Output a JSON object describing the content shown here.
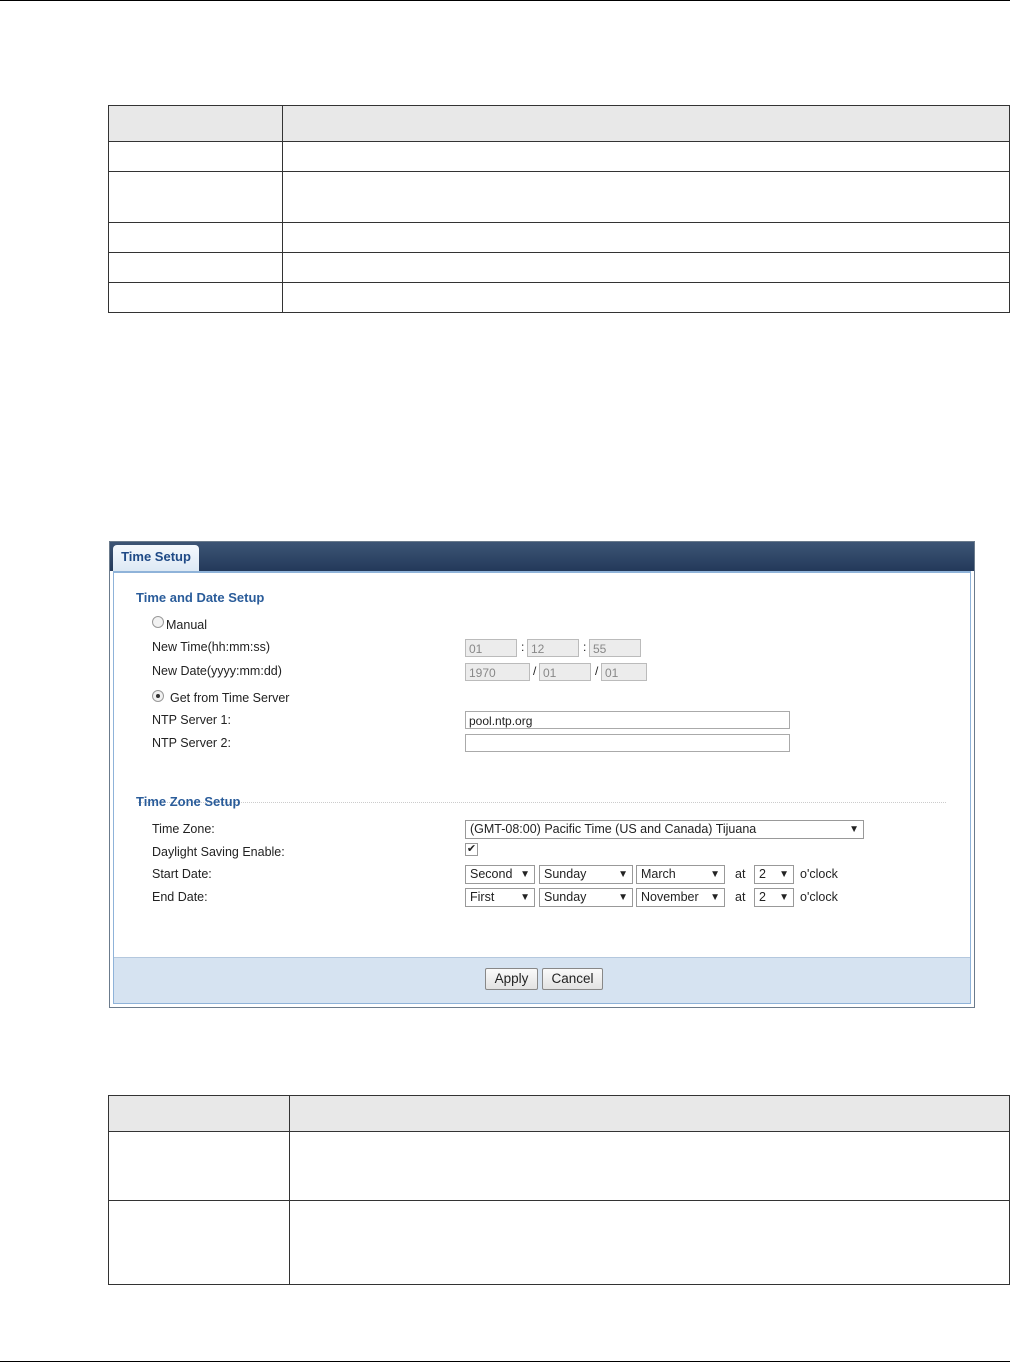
{
  "panel": {
    "tab_label": "Time Setup",
    "date_section": {
      "title": "Time and Date Setup",
      "manual_label": "Manual",
      "new_time_label": "New Time(hh:mm:ss)",
      "time_hh": "01",
      "time_mm": "12",
      "time_ss": "55",
      "time_sep": ":",
      "new_date_label": "New Date(yyyy:mm:dd)",
      "date_yyyy": "1970",
      "date_mm": "01",
      "date_dd": "01",
      "date_sep": "/",
      "server_label": "Get from Time Server",
      "ntp1_label": "NTP Server 1:",
      "ntp1_value": "pool.ntp.org",
      "ntp2_label": "NTP Server 2:",
      "ntp2_value": ""
    },
    "zone_section": {
      "title": "Time Zone Setup",
      "zone_label": "Time Zone:",
      "zone_value": "(GMT-08:00) Pacific Time (US and Canada) Tijuana",
      "dst_label": "Daylight Saving Enable:",
      "dst_checked": true,
      "start_label": "Start Date:",
      "start_week": "Second",
      "start_day": "Sunday",
      "start_month": "March",
      "start_hour": "2",
      "end_label": "End Date:",
      "end_week": "First",
      "end_day": "Sunday",
      "end_month": "November",
      "end_hour": "2",
      "at_label": "at",
      "oclock_label": "o'clock"
    },
    "apply_label": "Apply",
    "cancel_label": "Cancel"
  },
  "icons": {
    "dropdown": "dropdown-arrow-icon",
    "check": "checkmark-icon"
  }
}
